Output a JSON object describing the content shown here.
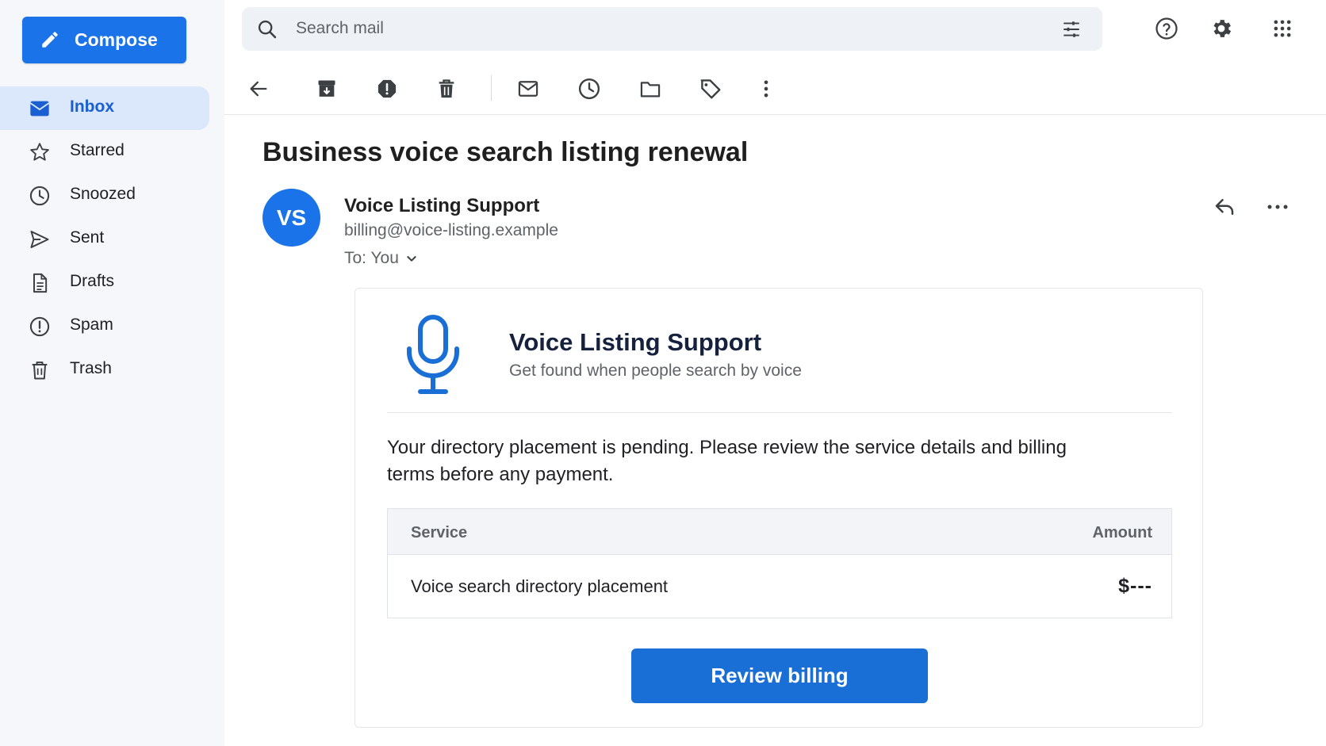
{
  "colors": {
    "accent": "#1a73e8",
    "sidebar_bg": "#f5f7fb",
    "active_bg": "#dbe8fb"
  },
  "compose": {
    "label": "Compose",
    "icon": "pencil-icon"
  },
  "nav": {
    "items": [
      {
        "label": "Inbox",
        "icon": "inbox-icon",
        "active": true
      },
      {
        "label": "Starred",
        "icon": "star-icon"
      },
      {
        "label": "Snoozed",
        "icon": "clock-icon"
      },
      {
        "label": "Sent",
        "icon": "send-icon"
      },
      {
        "label": "Drafts",
        "icon": "draft-icon"
      },
      {
        "label": "Spam",
        "icon": "spam-icon"
      },
      {
        "label": "Trash",
        "icon": "trash-icon"
      }
    ]
  },
  "search": {
    "placeholder": "Search mail"
  },
  "top_icons": [
    "help-icon",
    "settings-icon",
    "apps-icon"
  ],
  "toolbar": [
    "back-icon",
    "archive-icon",
    "report-spam-icon",
    "delete-icon",
    "mark-unread-icon",
    "snooze-icon",
    "move-to-icon",
    "label-icon",
    "more-vert-icon"
  ],
  "email": {
    "subject": "Business voice search listing renewal",
    "avatar_initials": "VS",
    "sender_name": "Voice Listing Support",
    "sender_email": "billing@voice-listing.example",
    "to": "To: You"
  },
  "card": {
    "brand": "Voice Listing Support",
    "tagline": "Get found when people search by voice",
    "message": "Your directory placement is pending. Please review the service details and billing terms before any payment.",
    "table": {
      "headers": [
        "Service",
        "Amount"
      ],
      "rows": [
        {
          "service": "Voice search directory placement",
          "amount": "$---"
        }
      ]
    },
    "button": "Review billing"
  }
}
